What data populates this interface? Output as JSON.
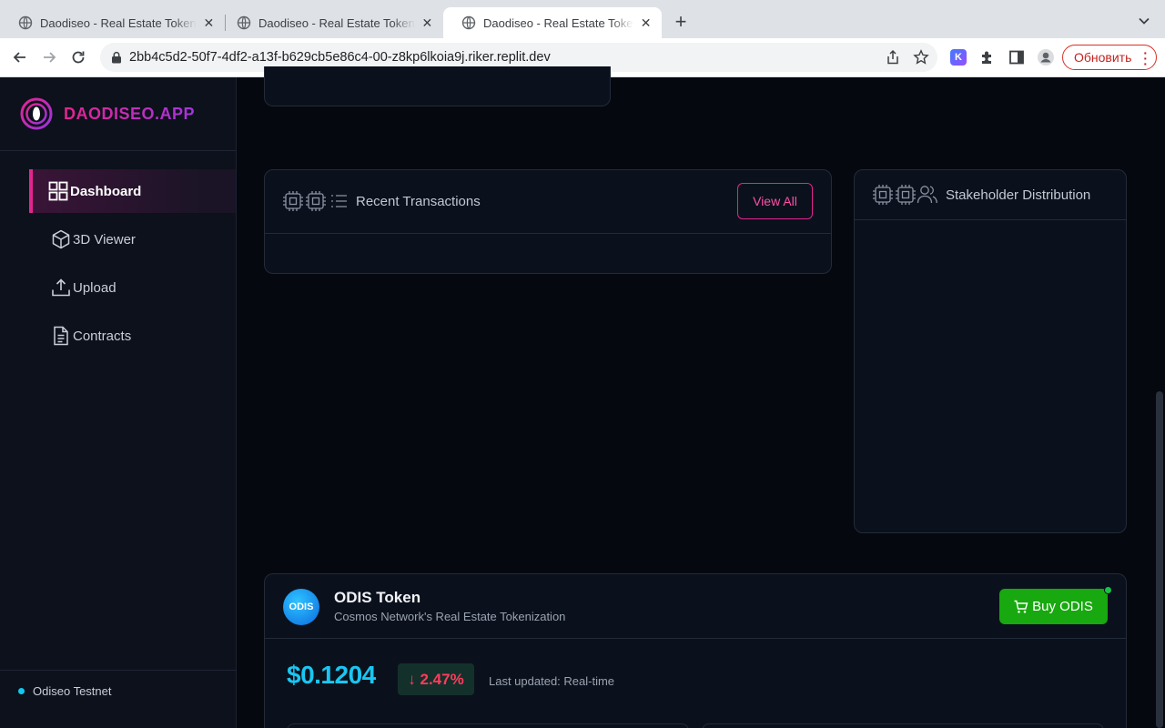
{
  "browser": {
    "tabs": [
      {
        "title": "Daodiseo - Real Estate Tokeniz",
        "active": false
      },
      {
        "title": "Daodiseo - Real Estate Tokeniz",
        "active": false
      },
      {
        "title": "Daodiseo - Real Estate Tokeniz",
        "active": true
      }
    ],
    "url": "2bb4c5d2-50f7-4df2-a13f-b629cb5e86c4-00-z8kp6lkoia9j.riker.replit.dev",
    "update_button": "Обновить",
    "extension_label": "K"
  },
  "sidebar": {
    "brand": "DAODISEO.APP",
    "items": [
      {
        "label": "Dashboard",
        "icon": "grid-icon",
        "active": true
      },
      {
        "label": "3D Viewer",
        "icon": "cube-icon",
        "active": false
      },
      {
        "label": "Upload",
        "icon": "upload-icon",
        "active": false
      },
      {
        "label": "Contracts",
        "icon": "document-icon",
        "active": false
      }
    ],
    "network": "Odiseo Testnet"
  },
  "transactions": {
    "title": "Recent Transactions",
    "view_all": "View All"
  },
  "stakeholders": {
    "title": "Stakeholder Distribution"
  },
  "token": {
    "logo_text": "ODIS",
    "name": "ODIS Token",
    "subtitle": "Cosmos Network's Real Estate Tokenization",
    "buy_label": "Buy ODIS",
    "price": "$0.1204",
    "change": "↓ 2.47%",
    "updated": "Last updated: Real-time"
  },
  "colors": {
    "accent_pink": "#e2258f",
    "accent_purple": "#a733e0",
    "price_blue": "#19c6f2",
    "buy_green": "#18a80f",
    "down_red": "#ff3b5c"
  }
}
